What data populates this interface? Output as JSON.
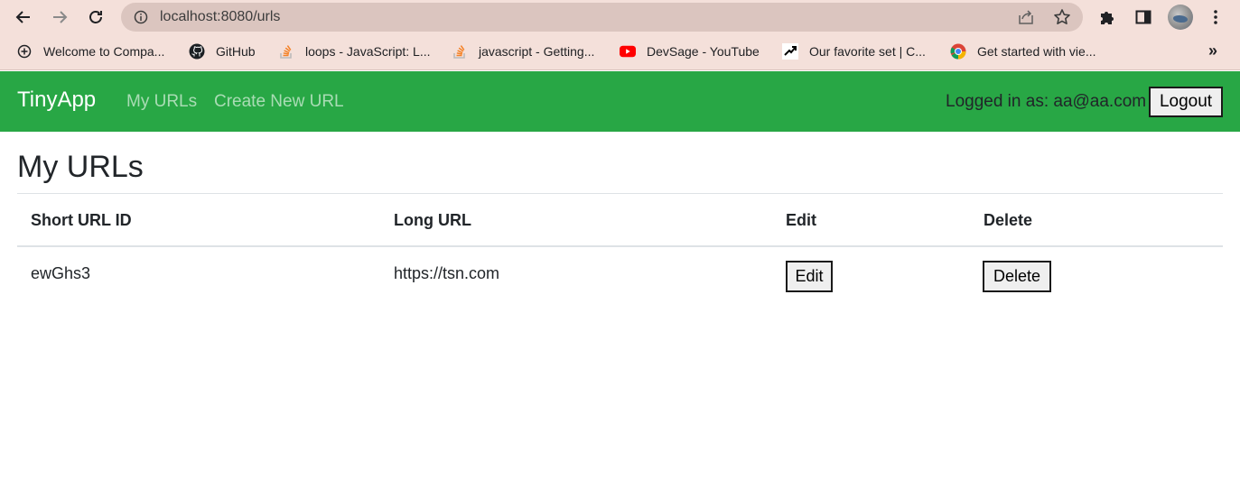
{
  "browser": {
    "url": "localhost:8080/urls",
    "bookmarks": [
      {
        "label": "Welcome to Compa...",
        "icon": "add-circle-icon"
      },
      {
        "label": "GitHub",
        "icon": "github-icon"
      },
      {
        "label": "loops - JavaScript: L...",
        "icon": "stackoverflow-icon"
      },
      {
        "label": "javascript - Getting...",
        "icon": "stackoverflow-icon"
      },
      {
        "label": "DevSage - YouTube",
        "icon": "youtube-icon"
      },
      {
        "label": "Our favorite set | C...",
        "icon": "site-icon"
      },
      {
        "label": "Get started with vie...",
        "icon": "chrome-icon"
      }
    ],
    "more_label": "»"
  },
  "nav": {
    "brand": "TinyApp",
    "links": [
      "My URLs",
      "Create New URL"
    ],
    "logged_in": "Logged in as: aa@aa.com",
    "logout_label": "Logout",
    "bg_color": "#28a745"
  },
  "main": {
    "title": "My URLs",
    "table": {
      "headers": [
        "Short URL ID",
        "Long URL",
        "Edit",
        "Delete"
      ],
      "rows": [
        {
          "short_id": "ewGhs3",
          "long_url": "https://tsn.com",
          "edit_label": "Edit",
          "delete_label": "Delete"
        }
      ]
    }
  }
}
